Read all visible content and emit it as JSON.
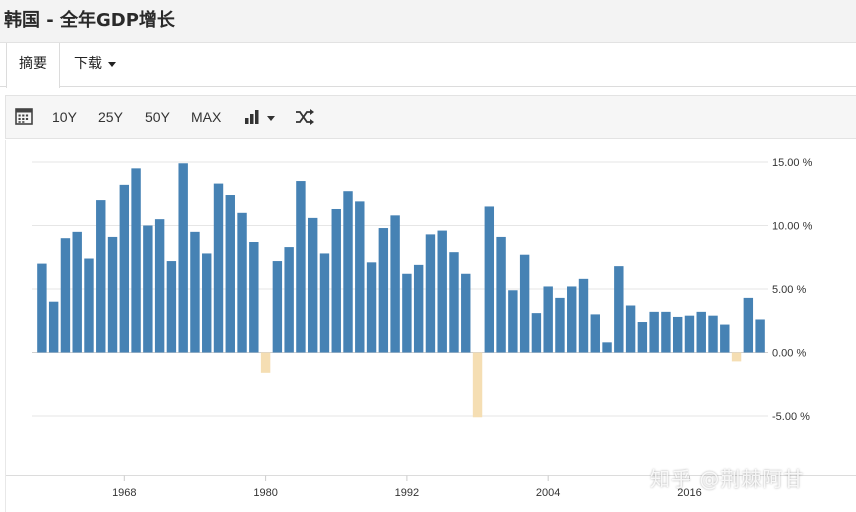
{
  "page": {
    "title": "韩国 - 全年GDP增长"
  },
  "tabs": {
    "summary": "摘要",
    "download": "下载"
  },
  "toolbar": {
    "calendar_icon": "calendar-icon",
    "ranges": [
      "10Y",
      "25Y",
      "50Y",
      "MAX"
    ],
    "chart_type_icon": "bar-chart-icon",
    "shuffle_icon": "shuffle-icon"
  },
  "colors": {
    "positive": "#4682b4",
    "negative": "#f5deb3",
    "grid": "#e6e6e6",
    "text": "#333333"
  },
  "watermark": "知乎 @荆棘阿甘",
  "chart_data": {
    "type": "bar",
    "title": "",
    "xlabel": "",
    "ylabel": "",
    "ylim": [
      -5,
      15
    ],
    "ytick_values": [
      15,
      10,
      5,
      0,
      -5
    ],
    "ytick_labels": [
      "15.00 %",
      "10.00 %",
      "5.00 %",
      "0.00 %",
      "-5.00 %"
    ],
    "xtick_years": [
      1968,
      1980,
      1992,
      2004,
      2016
    ],
    "xtick_labels": [
      "1968",
      "1980",
      "1992",
      "2004",
      "2016"
    ],
    "years": [
      1961,
      1962,
      1963,
      1964,
      1965,
      1966,
      1967,
      1968,
      1969,
      1970,
      1971,
      1972,
      1973,
      1974,
      1975,
      1976,
      1977,
      1978,
      1979,
      1980,
      1981,
      1982,
      1983,
      1984,
      1985,
      1986,
      1987,
      1988,
      1989,
      1990,
      1991,
      1992,
      1993,
      1994,
      1995,
      1996,
      1997,
      1998,
      1999,
      2000,
      2001,
      2002,
      2003,
      2004,
      2005,
      2006,
      2007,
      2008,
      2009,
      2010,
      2011,
      2012,
      2013,
      2014,
      2015,
      2016,
      2017,
      2018,
      2019,
      2020,
      2021,
      2022
    ],
    "values": [
      7.0,
      4.0,
      9.0,
      9.5,
      7.4,
      12.0,
      9.1,
      13.2,
      14.5,
      10.0,
      10.5,
      7.2,
      14.9,
      9.5,
      7.8,
      13.3,
      12.4,
      11.0,
      8.7,
      -1.6,
      7.2,
      8.3,
      13.5,
      10.6,
      7.8,
      11.3,
      12.7,
      11.9,
      7.1,
      9.8,
      10.8,
      6.2,
      6.9,
      9.3,
      9.6,
      7.9,
      6.2,
      -5.1,
      11.5,
      9.1,
      4.9,
      7.7,
      3.1,
      5.2,
      4.3,
      5.2,
      5.8,
      3.0,
      0.8,
      6.8,
      3.7,
      2.4,
      3.2,
      3.2,
      2.8,
      2.9,
      3.2,
      2.9,
      2.2,
      -0.7,
      4.3,
      2.6
    ]
  }
}
